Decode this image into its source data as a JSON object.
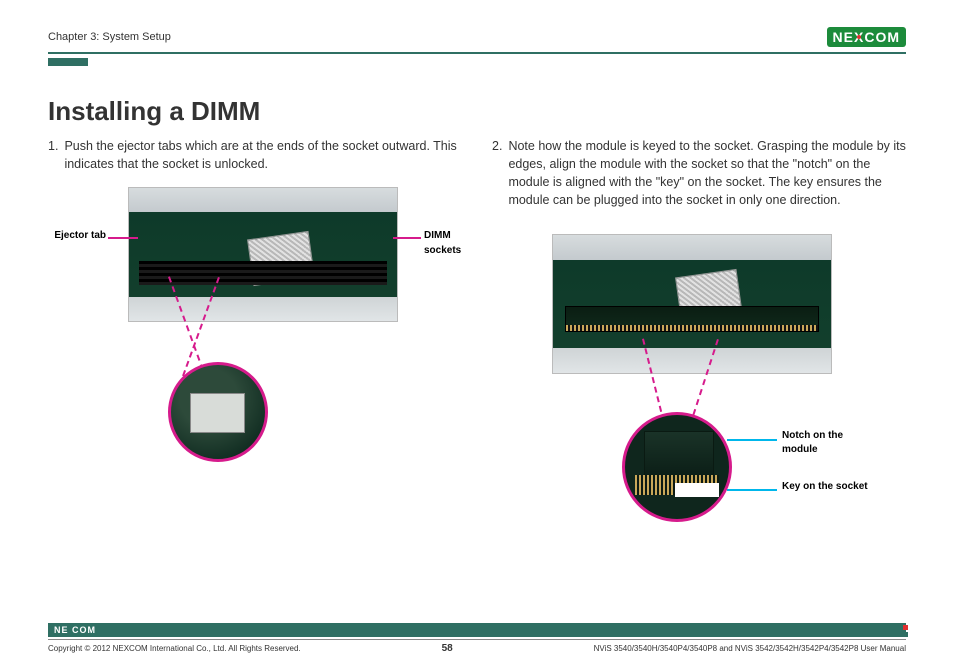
{
  "header": {
    "chapter": "Chapter 3: System Setup",
    "logo_text_left": "NE",
    "logo_text_x": "X",
    "logo_text_right": "COM"
  },
  "title": "Installing a DIMM",
  "left_col": {
    "step_num": "1.",
    "step_text": "Push the ejector tabs which are at the ends of the socket outward. This indicates that the socket is unlocked.",
    "label_ejector": "Ejector tab",
    "label_dimm_sockets": "DIMM sockets"
  },
  "right_col": {
    "step_num": "2.",
    "step_text": "Note how the module is keyed to the socket. Grasping the module by its edges, align the module with the socket so that the \"notch\" on the module is aligned with the \"key\" on the socket. The key ensures the module can be plugged into the socket in only one direction.",
    "label_notch": "Notch on the module",
    "label_key": "Key on the socket"
  },
  "footer": {
    "logo_small": "NE COM",
    "copyright": "Copyright © 2012 NEXCOM International Co., Ltd. All Rights Reserved.",
    "page_number": "58",
    "doc_ref": "NViS 3540/3540H/3540P4/3540P8 and NViS 3542/3542H/3542P4/3542P8 User Manual"
  }
}
